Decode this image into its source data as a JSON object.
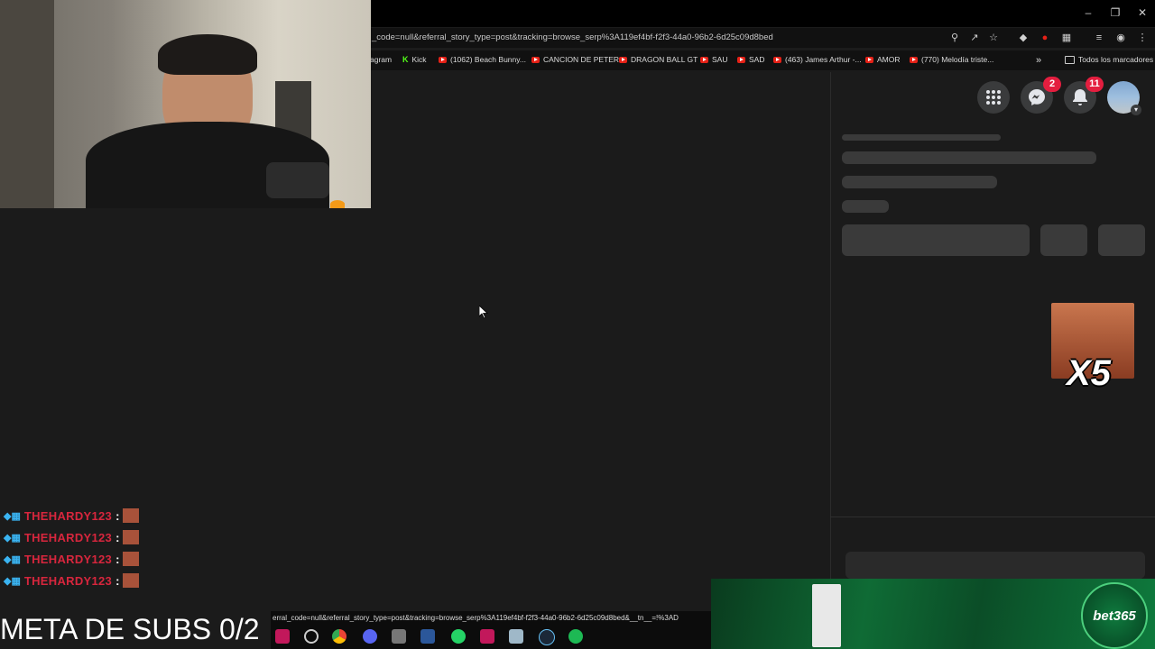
{
  "browser": {
    "url": "_code=null&referral_story_type=post&tracking=browse_serp%3A119ef4bf-f2f3-44a0-96b2-6d25c09d8bed",
    "status_url": "erral_code=null&referral_story_type=post&tracking=browse_serp%3A119ef4bf-f2f3-44a0-96b2-6d25c09d8bed&__tn__=!%3AD",
    "bookmarks": [
      {
        "label": "agram",
        "icon": "instagram-icon"
      },
      {
        "label": "Kick",
        "icon": "kick-icon"
      },
      {
        "label": "(1062) Beach Bunny...",
        "icon": "youtube-icon"
      },
      {
        "label": "CANCION DE PETER",
        "icon": "youtube-icon"
      },
      {
        "label": "DRAGON BALL GT",
        "icon": "youtube-icon"
      },
      {
        "label": "SAU",
        "icon": "youtube-icon"
      },
      {
        "label": "SAD",
        "icon": "youtube-icon"
      },
      {
        "label": "(463) James Arthur -...",
        "icon": "youtube-icon"
      },
      {
        "label": "AMOR",
        "icon": "youtube-icon"
      },
      {
        "label": "(770) Melodía triste...",
        "icon": "youtube-icon"
      }
    ],
    "overflow": "»",
    "all_bookmarks": "Todos los marcadores"
  },
  "facebook": {
    "messenger_badge": "2",
    "notifications_badge": "11"
  },
  "chat": [
    {
      "user": "THEHARDY123",
      "sep": ":"
    },
    {
      "user": "THEHARDY123",
      "sep": ":"
    },
    {
      "user": "THEHARDY123",
      "sep": ":"
    },
    {
      "user": "THEHARDY123",
      "sep": ":"
    }
  ],
  "overlay": {
    "meta_subs": "META DE SUBS 0/2",
    "emote_text": "X5",
    "ad_brand": "bet365"
  },
  "colors": {
    "accent_red": "#e41e3f",
    "chat_name": "#d7263d",
    "bet365_green": "#0f7a3e"
  }
}
